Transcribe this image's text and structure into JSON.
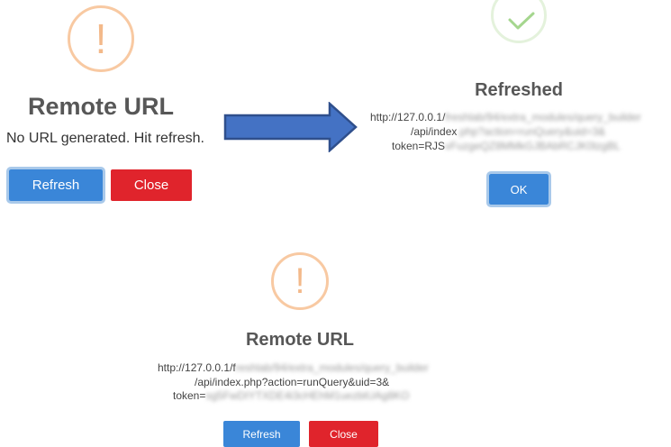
{
  "left_dialog": {
    "icon": "warning-icon",
    "glyph": "!",
    "title": "Remote URL",
    "message": "No URL generated. Hit refresh.",
    "refresh_label": "Refresh",
    "close_label": "Close"
  },
  "arrow": {
    "icon": "right-arrow-icon",
    "color": "#3a5a98"
  },
  "right_dialog": {
    "icon": "check-icon",
    "title": "Refreshed",
    "url_line1_visible": "http://127.0.0.1/",
    "url_line1_blurred": "freshlab/94/extra_modules/query_builder",
    "url_line2_visible": "/api/index",
    "url_line2_blurred": ".php?action=runQuery&uid=3&",
    "url_line3_visible": "token=RJS",
    "url_line3_blurred": "vFuzgeQZ8MMkGJBAbRCJK0lzgBL",
    "ok_label": "OK"
  },
  "bottom_dialog": {
    "icon": "warning-icon",
    "glyph": "!",
    "title": "Remote URL",
    "url_line1_visible": "http://127.0.0.1/f",
    "url_line1_blurred": "reshlab/94/extra_modules/query_builder",
    "url_line2_visible": "/api/index.php?action=runQuery&uid=3&",
    "url_line3_visible": "token=",
    "url_line3_blurred": "sg5FwDIYTXDE4i3cHEhM1uezbtUAg8KO",
    "refresh_label": "Refresh",
    "close_label": "Close"
  },
  "colors": {
    "primary": "#3a86d8",
    "danger": "#e0242c",
    "warning": "#f8c9a2",
    "success": "#a5d68e"
  }
}
